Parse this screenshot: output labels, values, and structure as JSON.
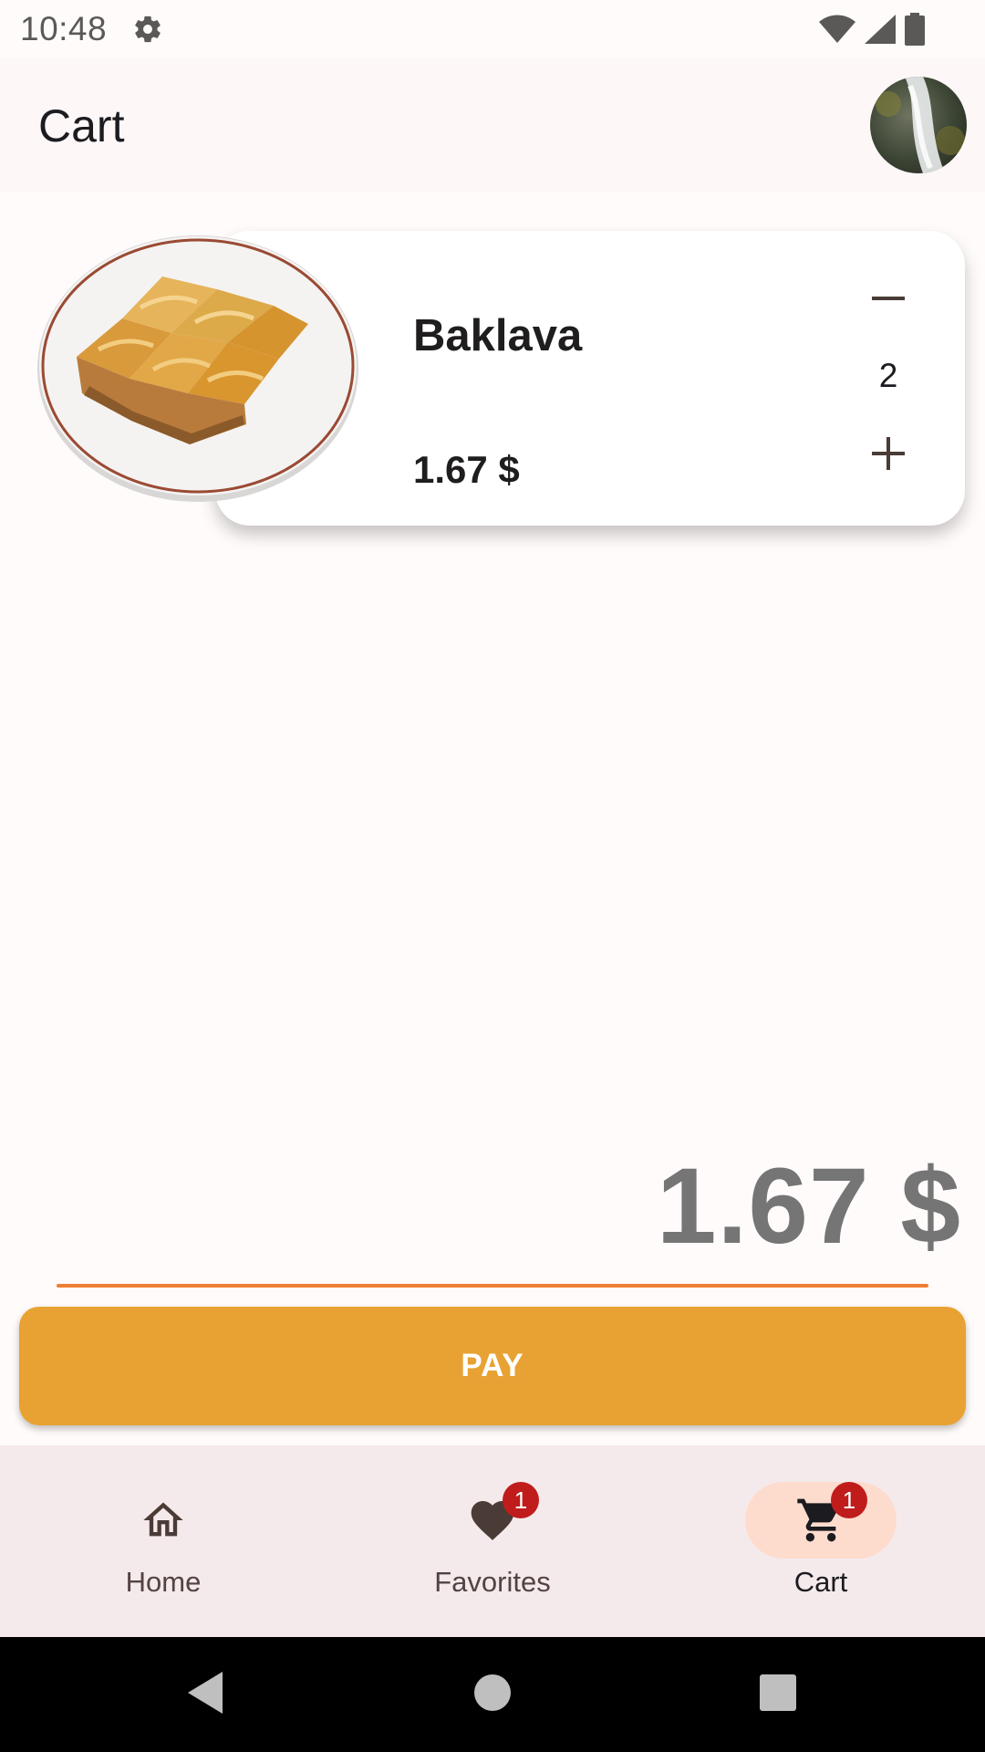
{
  "status_bar": {
    "time": "10:48",
    "icons": [
      "settings-icon",
      "wifi-icon",
      "signal-icon",
      "battery-icon"
    ]
  },
  "app_bar": {
    "title": "Cart",
    "avatar": "profile-avatar"
  },
  "cart_items": [
    {
      "name": "Baklava",
      "price": "1.67 $",
      "quantity": "2",
      "image": "baklava-plate-image"
    }
  ],
  "total": {
    "amount": "1.67 $"
  },
  "pay_button": {
    "label": "PAY"
  },
  "bottom_nav": {
    "items": [
      {
        "label": "Home",
        "icon": "home-icon",
        "badge": null,
        "selected": false
      },
      {
        "label": "Favorites",
        "icon": "heart-icon",
        "badge": "1",
        "selected": false
      },
      {
        "label": "Cart",
        "icon": "cart-icon",
        "badge": "1",
        "selected": true
      }
    ]
  },
  "colors": {
    "accent": "#e8a233",
    "divider": "#ef7f32",
    "badge": "#c01c1c",
    "nav_selected_pill": "#fddcce",
    "nav_background": "#f5eaeb"
  }
}
